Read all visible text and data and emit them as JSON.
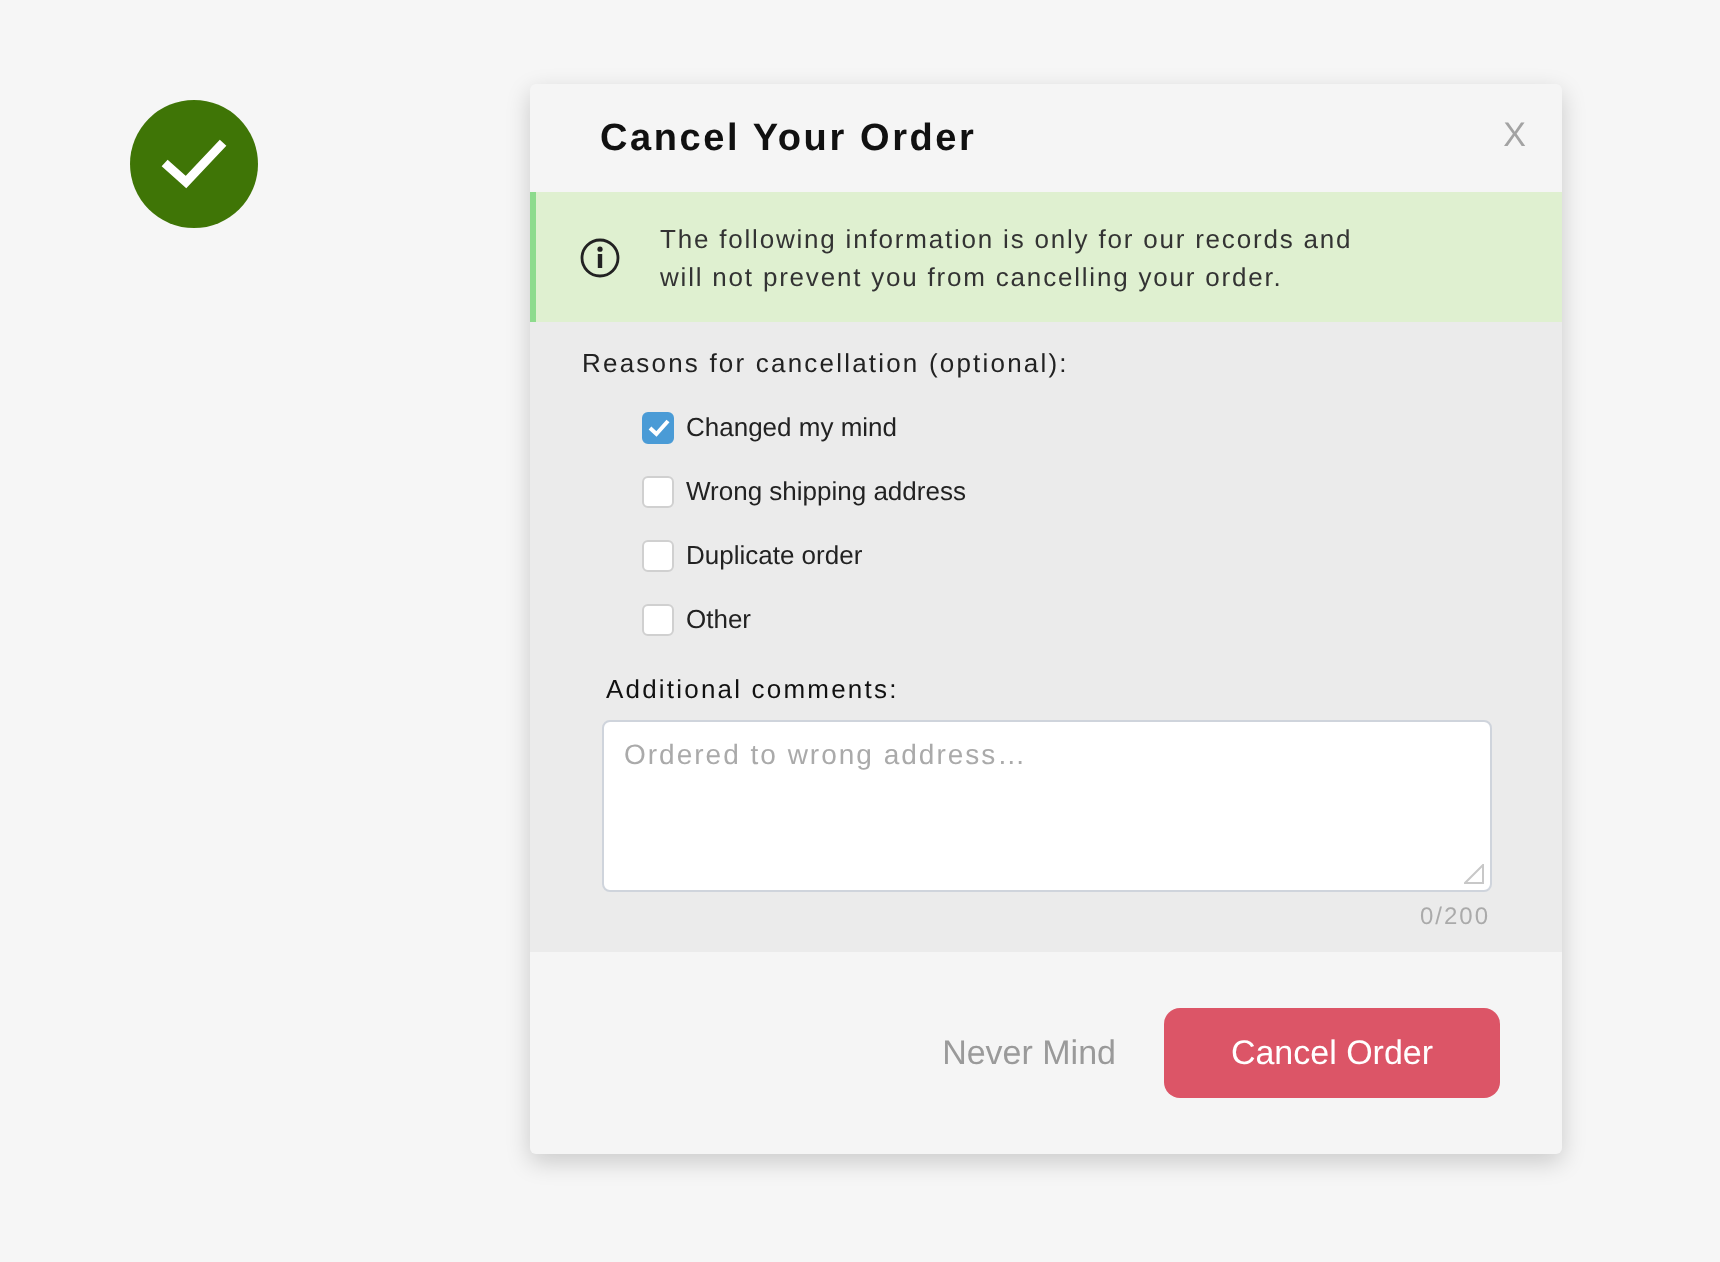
{
  "dialog": {
    "title": "Cancel Your Order",
    "close_label": "X"
  },
  "notice": {
    "text": "The following information is only for our records and will not prevent you from cancelling your order."
  },
  "reasons": {
    "label": "Reasons for cancellation (optional):",
    "options": [
      {
        "label": "Changed my mind",
        "checked": true
      },
      {
        "label": "Wrong shipping address",
        "checked": false
      },
      {
        "label": "Duplicate order",
        "checked": false
      },
      {
        "label": "Other",
        "checked": false
      }
    ]
  },
  "comments": {
    "label": "Additional comments:",
    "placeholder": "Ordered to wrong address…",
    "counter": "0/200"
  },
  "buttons": {
    "secondary": "Never Mind",
    "primary": "Cancel Order"
  }
}
